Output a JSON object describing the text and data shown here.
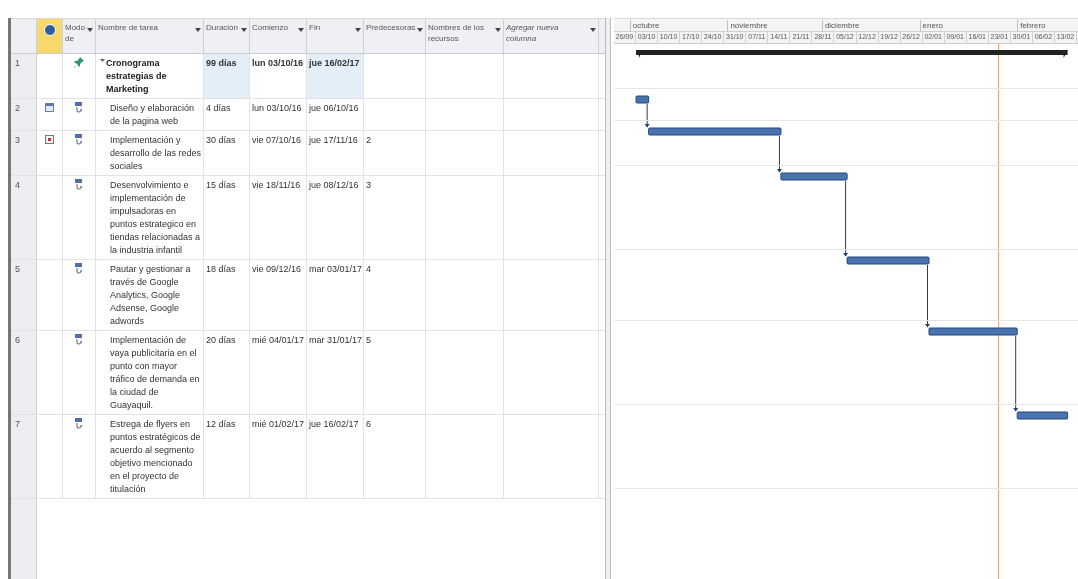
{
  "columns": [
    {
      "label": "Modo de"
    },
    {
      "label": "Nombre de tarea"
    },
    {
      "label": "Duración"
    },
    {
      "label": "Comienzo"
    },
    {
      "label": "Fin"
    },
    {
      "label": "Predecesoras"
    },
    {
      "label": "Nombres de los recursos"
    },
    {
      "label": "Agregar nueva columna"
    }
  ],
  "timescale": {
    "months": [
      "octubre",
      "noviembre",
      "diciembre",
      "enero",
      "febrero"
    ],
    "weeks": [
      "26/09",
      "03/10",
      "10/10",
      "17/10",
      "24/10",
      "31/10",
      "07/11",
      "14/11",
      "21/11",
      "28/11",
      "05/12",
      "12/12",
      "19/12",
      "26/12",
      "02/01",
      "09/01",
      "16/01",
      "23/01",
      "30/01",
      "06/02",
      "13/02"
    ]
  },
  "tasks": [
    {
      "id": "1",
      "mode": {
        "kind": "manual"
      },
      "summary": true,
      "name": "Cronograma estrategias de Marketing",
      "duration": "99 días",
      "start": "lun 03/10/16",
      "finish": "jue 16/02/17"
    },
    {
      "id": "2",
      "indicator": {
        "kind": "calendar"
      },
      "mode": {
        "kind": "auto"
      },
      "summary": false,
      "name": "Diseño y elaboración de la pagina web",
      "duration": "4 días",
      "start": "lun 03/10/16",
      "finish": "jue 06/10/16"
    },
    {
      "id": "3",
      "indicator": {
        "kind": "note"
      },
      "mode": {
        "kind": "auto"
      },
      "summary": false,
      "name": "Implementación y desarrollo de las redes sociales",
      "duration": "30 días",
      "start": "vie 07/10/16",
      "finish": "jue 17/11/16",
      "predecessors": "2"
    },
    {
      "id": "4",
      "mode": {
        "kind": "auto"
      },
      "summary": false,
      "name": "Desenvolvimiento e implementación de impulsadoras en puntos estrategico en tiendas relacionadas a la industria infantil",
      "duration": "15 días",
      "start": "vie 18/11/16",
      "finish": "jue 08/12/16",
      "predecessors": "3"
    },
    {
      "id": "5",
      "mode": {
        "kind": "auto"
      },
      "summary": false,
      "name": "Pautar y gestionar a través de Google Analytics, Google Adsense, Google adwords",
      "duration": "18 días",
      "start": "vie 09/12/16",
      "finish": "mar 03/01/17",
      "predecessors": "4"
    },
    {
      "id": "6",
      "mode": {
        "kind": "auto"
      },
      "summary": false,
      "name": "Implementación de vaya publicitaria en el punto con mayor tráfico de demanda en la ciudad de Guayaquil.",
      "duration": "20 días",
      "start": "mié 04/01/17",
      "finish": "mar 31/01/17",
      "predecessors": "5"
    },
    {
      "id": "7",
      "mode": {
        "kind": "auto"
      },
      "summary": false,
      "name": "Estrega de flyers en puntos estratégicos de acuerdo al segmento objetivo mencionado en el proyecto de titulación",
      "duration": "12 días",
      "start": "mié 01/02/17",
      "finish": "jue 16/02/17",
      "predecessors": "6"
    }
  ]
}
